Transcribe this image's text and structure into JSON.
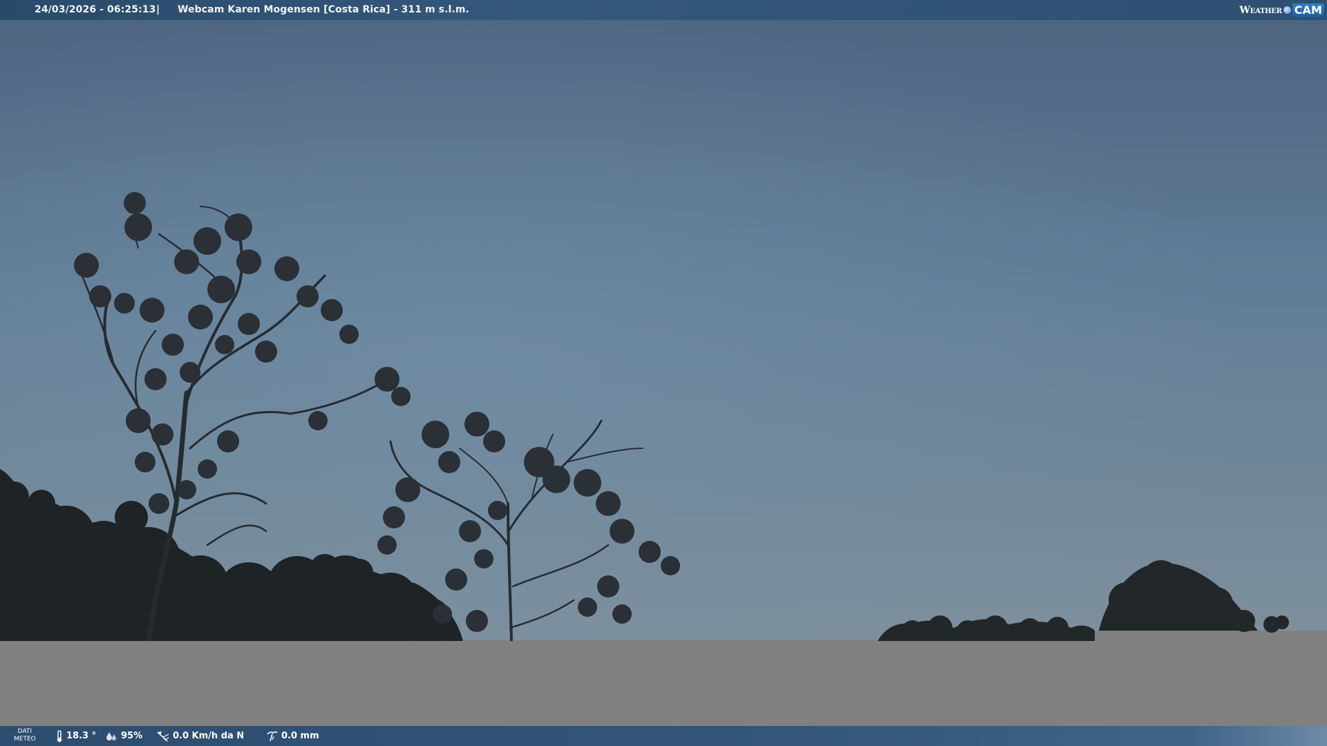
{
  "header": {
    "datetime": "24/03/2026 - 06:25:13",
    "separator": "|",
    "camera_title": "Webcam Karen Mogensen [Costa Rica]  - 311 m s.l.m.",
    "brand_weather": "Weather",
    "brand_cam": "CAM"
  },
  "weather_data": {
    "label_line1": "DATI",
    "label_line2": "METEO",
    "temperature": "18.3 °",
    "humidity": "95%",
    "wind": "0.0 Km/h da N",
    "rain": "0.0 mm"
  },
  "icons": {
    "temperature": "thermometer-icon",
    "humidity": "humidity-drops-icon",
    "wind": "wind-vane-icon",
    "rain": "rain-gauge-icon"
  },
  "colors": {
    "header_bg": "#2d4f72",
    "sky_top": "#4f6680",
    "sky_bottom": "#7d919e",
    "gray_band": "#808080"
  }
}
